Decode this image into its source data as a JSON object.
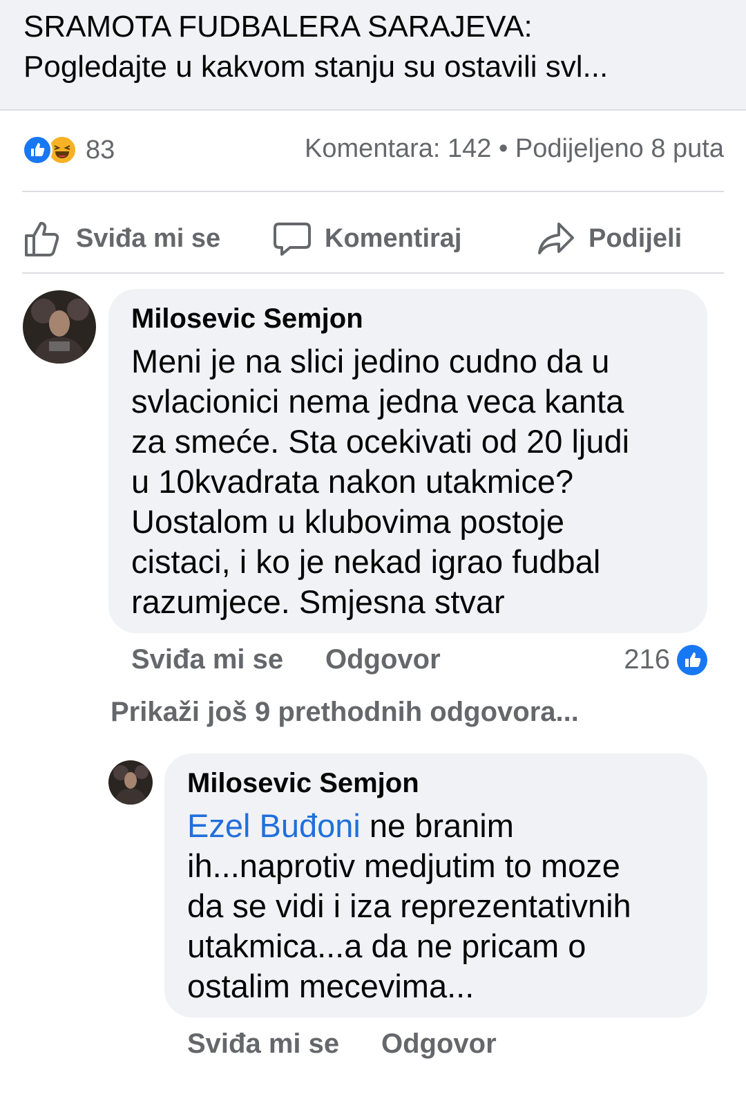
{
  "post": {
    "title_line1": "SRAMOTA FUDBALERA SARAJEVA:",
    "title_line2": "Pogledajte u kakvom stanju su ostavili svl..."
  },
  "stats": {
    "reaction_count": "83",
    "summary": "Komentara: 142 • Podijeljeno 8 puta"
  },
  "actions": {
    "like": "Sviđa mi se",
    "comment": "Komentiraj",
    "share": "Podijeli"
  },
  "comments": [
    {
      "author": "Milosevic Semjon",
      "lines": [
        "Meni je na slici jedino cudno da u",
        "svlacionici nema jedna veca kanta",
        "za smeće. Sta ocekivati od 20 ljudi",
        "u 10kvadrata nakon utakmice?",
        "Uostalom  u klubovima postoje",
        "cistaci, i ko je nekad igrao fudbal",
        "razumjece. Smjesna stvar"
      ],
      "like_label": "Sviđa mi se",
      "reply_label": "Odgovor",
      "like_count": "216"
    }
  ],
  "more_replies": "Prikaži još 9 prethodnih odgovora...",
  "reply": {
    "author": "Milosevic Semjon",
    "mention": "Ezel Buđoni",
    "first_line_rest": " ne branim",
    "lines": [
      "ih...naprotiv medjutim to moze",
      "da se vidi i iza reprezentativnih",
      "utakmica...a da ne pricam o",
      "ostalim mecevima..."
    ],
    "like_label": "Sviđa mi se",
    "reply_label": "Odgovor"
  },
  "icons": {
    "like_reaction": "like-reaction-icon",
    "haha_reaction": "haha-reaction-icon",
    "like": "thumbs-up-icon",
    "comment": "comment-bubble-icon",
    "share": "share-arrow-icon"
  },
  "colors": {
    "accent": "#1877f2",
    "mention": "#216fdb",
    "secondary_text": "#65676b",
    "bubble": "#f0f2f5"
  }
}
